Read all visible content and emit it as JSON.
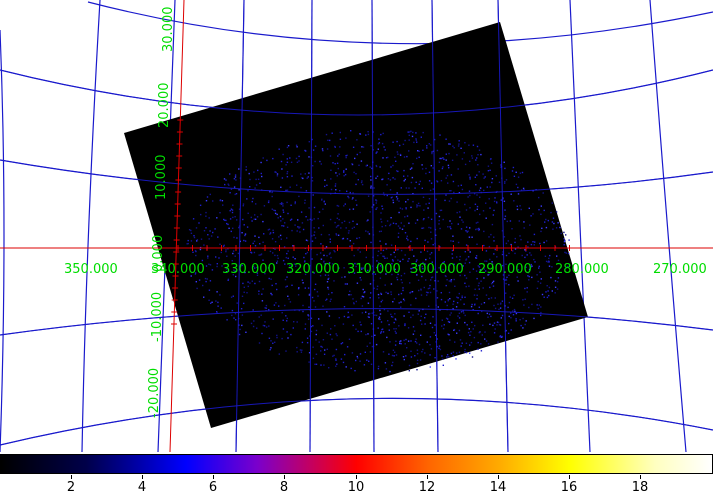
{
  "ra_labels": [
    "350.000",
    "340.000",
    "330.000",
    "320.000",
    "310.000",
    "300.000",
    "290.000",
    "280.000",
    "270.000"
  ],
  "dec_labels": [
    "30.000",
    "20.000",
    "10.000",
    "0.000",
    "-10.000",
    "-20.000"
  ],
  "colorbar": {
    "ticks": [
      "2",
      "4",
      "6",
      "8",
      "10",
      "12",
      "14",
      "16",
      "18"
    ]
  },
  "colors": {
    "grid": "#1a1acc",
    "crosshair": "#dd0000",
    "label": "#00dd00",
    "image_background": "#000000",
    "data": "#2222ff"
  }
}
